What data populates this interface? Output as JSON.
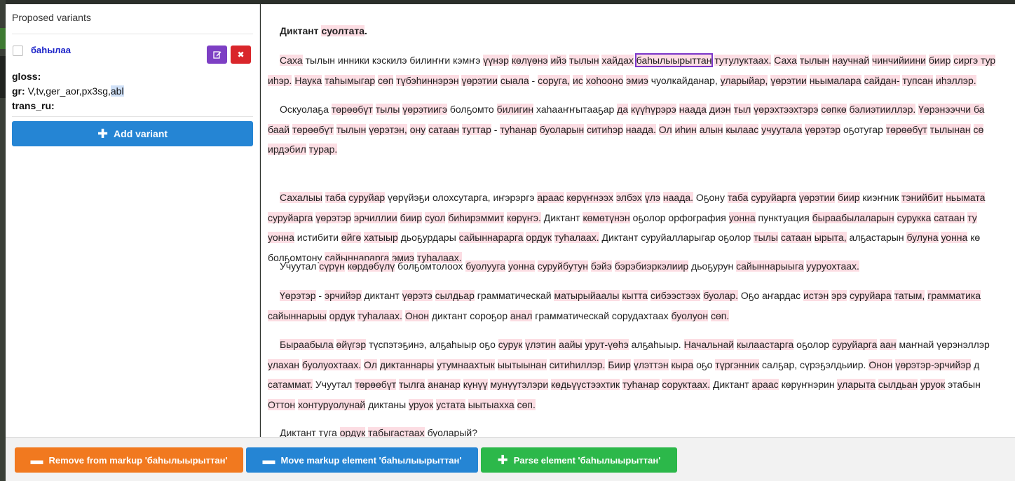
{
  "left_panel": {
    "title": "Proposed variants",
    "variant": {
      "word": "баһылаа",
      "edit_icon": "pencil-icon",
      "delete_icon": "close-icon",
      "gloss_label": "gloss:",
      "gloss_value": "",
      "gr_label": "gr:",
      "gr_value": "V,tv,ger_aor,px3sg,",
      "gr_selected": "abl",
      "trans_label": "trans_ru:",
      "trans_value": ""
    },
    "add_button": "Add variant"
  },
  "text": {
    "title_word1": "Диктант",
    "title_word2": "суолтата",
    "p1": {
      "a": "Саха",
      "b": " тылын",
      "c": " инники кэскилэ билиҥҥи кэмҥэ ",
      "d": "үүнэр",
      "e": " ",
      "f": "көлүөнэ",
      "g": " ",
      "h": "ийэ",
      "i": " ",
      "j": "тылын",
      "k": " ",
      "l": "хайдах",
      "m": " ",
      "boxed": "баһылыырыттан",
      "n": " ",
      "o": "тутулуктаах.",
      "p": " ",
      "q": "Саха",
      "r": " ",
      "s": "тылын",
      "t": " ",
      "u": "научнай",
      "v": " ",
      "w": "чинчийиини",
      "x": " ",
      "y": "биир",
      "z": " ",
      "aa": "сиргэ",
      "ab": " тур",
      "line2a": "иһэр.",
      "line2b": " ",
      "line2c": "Наука",
      "line2d": " ",
      "line2e": "таһымыгар",
      "line2f": " ",
      "line2g": "сөп",
      "line2h": " ",
      "line2i": "түбэһиннэрэн",
      "line2j": " ",
      "line2k": "үөрэтии",
      "line2l": " ",
      "line2m": "сыала",
      "line2n": " - ",
      "line2o": "соруга,",
      "line2p": " ",
      "line2q": "ис",
      "line2r": " ",
      "line2s": "хоһооно",
      "line2t": " ",
      "line2u": "эмиэ",
      "line2v": " чуолкайданар, ",
      "line2w": "уларыйар,",
      "line2x": " ",
      "line2y": "үөрэтии",
      "line2z": " ",
      "line2aa": "ньымалара",
      "line2ab": " ",
      "line2ac": "сайдан-",
      "line2ad": " ",
      "line2ae": "тупсан",
      "line2af": " ",
      "line2ag": "иһэллэр."
    },
    "p2_line1": [
      {
        "t": "Оскуолаҕа ",
        "h": false
      },
      {
        "t": "төрөөбүт",
        "h": true
      },
      {
        "t": " ",
        "h": false
      },
      {
        "t": "тылы",
        "h": true
      },
      {
        "t": " ",
        "h": false
      },
      {
        "t": "үөрэтиигэ",
        "h": true
      },
      {
        "t": " болҕомто ",
        "h": false
      },
      {
        "t": "билигин",
        "h": true
      },
      {
        "t": " хаһааҥҥытааҕар ",
        "h": false
      },
      {
        "t": "да",
        "h": true
      },
      {
        "t": " ",
        "h": false
      },
      {
        "t": "күүһүрэрэ",
        "h": true
      },
      {
        "t": " ",
        "h": false
      },
      {
        "t": "наада",
        "h": true
      },
      {
        "t": " ",
        "h": false
      },
      {
        "t": "диэн",
        "h": true
      },
      {
        "t": " ",
        "h": false
      },
      {
        "t": "тыл",
        "h": true
      },
      {
        "t": " ",
        "h": false
      },
      {
        "t": "үөрэхтээхтэрэ",
        "h": true
      },
      {
        "t": " ",
        "h": false
      },
      {
        "t": "сөпкө",
        "h": true
      },
      {
        "t": " ",
        "h": false
      },
      {
        "t": "бэлиэтииллэр.",
        "h": true
      },
      {
        "t": " ",
        "h": false
      },
      {
        "t": "Үөрэнээччи ба",
        "h": true
      }
    ],
    "p2_line2": [
      {
        "t": "баай",
        "h": true
      },
      {
        "t": " ",
        "h": false
      },
      {
        "t": "төрөөбүт",
        "h": true
      },
      {
        "t": " ",
        "h": false
      },
      {
        "t": "тылын",
        "h": true
      },
      {
        "t": " ",
        "h": false
      },
      {
        "t": "үөрэтэн,",
        "h": true
      },
      {
        "t": " ",
        "h": false
      },
      {
        "t": "ону",
        "h": true
      },
      {
        "t": " ",
        "h": false
      },
      {
        "t": "сатаан",
        "h": true
      },
      {
        "t": " ",
        "h": false
      },
      {
        "t": "туттар",
        "h": true
      },
      {
        "t": " - ",
        "h": false
      },
      {
        "t": "туһанар",
        "h": true
      },
      {
        "t": " ",
        "h": false
      },
      {
        "t": "буоларын",
        "h": true
      },
      {
        "t": " ",
        "h": false
      },
      {
        "t": "ситиһэр",
        "h": true
      },
      {
        "t": " ",
        "h": false
      },
      {
        "t": "наада.",
        "h": true
      },
      {
        "t": " ",
        "h": false
      },
      {
        "t": "Ол",
        "h": true
      },
      {
        "t": " ",
        "h": false
      },
      {
        "t": "иһин",
        "h": true
      },
      {
        "t": " ",
        "h": false
      },
      {
        "t": "алын",
        "h": true
      },
      {
        "t": " ",
        "h": false
      },
      {
        "t": "кылаас",
        "h": true
      },
      {
        "t": " ",
        "h": false
      },
      {
        "t": "учуутала",
        "h": true
      },
      {
        "t": " ",
        "h": false
      },
      {
        "t": "үөрэтэр",
        "h": true
      },
      {
        "t": " оҕотугар ",
        "h": false
      },
      {
        "t": "төрөөбүт",
        "h": true
      },
      {
        "t": " ",
        "h": false
      },
      {
        "t": "тылынан",
        "h": true
      },
      {
        "t": " ",
        "h": false
      },
      {
        "t": "сө",
        "h": true
      }
    ],
    "p2_line3": [
      {
        "t": "ирдэбил",
        "h": true
      },
      {
        "t": " ",
        "h": false
      },
      {
        "t": "турар.",
        "h": true
      }
    ],
    "p3_line1": [
      {
        "t": "Сахалыы",
        "h": true
      },
      {
        "t": " ",
        "h": false
      },
      {
        "t": "таба",
        "h": true
      },
      {
        "t": " ",
        "h": false
      },
      {
        "t": "суруйар",
        "h": true
      },
      {
        "t": " үөрүйэҕи олохсутарга, иҥэрэргэ ",
        "h": false
      },
      {
        "t": "араас",
        "h": true
      },
      {
        "t": " ",
        "h": false
      },
      {
        "t": "көрүҥнээх",
        "h": true
      },
      {
        "t": " ",
        "h": false
      },
      {
        "t": "элбэх",
        "h": true
      },
      {
        "t": " ",
        "h": false
      },
      {
        "t": "үлэ",
        "h": true
      },
      {
        "t": " ",
        "h": false
      },
      {
        "t": "наада.",
        "h": true
      },
      {
        "t": " Оҕону ",
        "h": false
      },
      {
        "t": "таба",
        "h": true
      },
      {
        "t": " ",
        "h": false
      },
      {
        "t": "суруйарга",
        "h": true
      },
      {
        "t": " ",
        "h": false
      },
      {
        "t": "үөрэтии",
        "h": true
      },
      {
        "t": " ",
        "h": false
      },
      {
        "t": "биир",
        "h": true
      },
      {
        "t": " киэҥник ",
        "h": false
      },
      {
        "t": "тэнийбит",
        "h": true
      },
      {
        "t": " ",
        "h": false
      },
      {
        "t": "ньымата",
        "h": true
      }
    ],
    "p3_line2": [
      {
        "t": "суруйарга",
        "h": true
      },
      {
        "t": " ",
        "h": false
      },
      {
        "t": "үөрэтэр",
        "h": true
      },
      {
        "t": " ",
        "h": false
      },
      {
        "t": "эрчиллии",
        "h": true
      },
      {
        "t": " ",
        "h": false
      },
      {
        "t": "биир",
        "h": true
      },
      {
        "t": " ",
        "h": false
      },
      {
        "t": "суол",
        "h": true
      },
      {
        "t": " ",
        "h": false
      },
      {
        "t": "биһирэммит",
        "h": true
      },
      {
        "t": " ",
        "h": false
      },
      {
        "t": "көрүҥэ.",
        "h": true
      },
      {
        "t": " Диктант ",
        "h": false
      },
      {
        "t": "көмөтүнэн",
        "h": true
      },
      {
        "t": " оҕолор орфография ",
        "h": false
      },
      {
        "t": "уонна",
        "h": true
      },
      {
        "t": " пунктуация ",
        "h": false
      },
      {
        "t": "быраабылаларын",
        "h": true
      },
      {
        "t": " ",
        "h": false
      },
      {
        "t": "сурукка",
        "h": true
      },
      {
        "t": " ",
        "h": false
      },
      {
        "t": "сатаан",
        "h": true
      },
      {
        "t": " ",
        "h": false
      },
      {
        "t": "ту",
        "h": true
      }
    ],
    "p3_line3": [
      {
        "t": "уонна",
        "h": true
      },
      {
        "t": " истибити ",
        "h": false
      },
      {
        "t": "өйгө",
        "h": true
      },
      {
        "t": " ",
        "h": false
      },
      {
        "t": "хатыыр",
        "h": true
      },
      {
        "t": " дьоҕурдары ",
        "h": false
      },
      {
        "t": "сайыннарарга",
        "h": true
      },
      {
        "t": " ",
        "h": false
      },
      {
        "t": "ордук",
        "h": true
      },
      {
        "t": " ",
        "h": false
      },
      {
        "t": "туһалаах.",
        "h": true
      },
      {
        "t": " Диктант суруйалларыгар оҕолор ",
        "h": false
      },
      {
        "t": "тылы",
        "h": true
      },
      {
        "t": " ",
        "h": false
      },
      {
        "t": "сатаан",
        "h": true
      },
      {
        "t": " ",
        "h": false
      },
      {
        "t": "ырыта,",
        "h": true
      },
      {
        "t": " алҕастарын ",
        "h": false
      },
      {
        "t": "булуна",
        "h": true
      },
      {
        "t": " ",
        "h": false
      },
      {
        "t": "уонна",
        "h": true
      },
      {
        "t": "  кө",
        "h": false
      }
    ],
    "p3_line4": [
      {
        "t": "болҕомтону ",
        "h": false
      },
      {
        "t": "сайыннарарга",
        "h": true
      },
      {
        "t": " ",
        "h": false
      },
      {
        "t": "эмиэ",
        "h": true
      },
      {
        "t": " ",
        "h": false
      },
      {
        "t": "туһалаах.",
        "h": true
      }
    ],
    "p4_line1": [
      {
        "t": "Учуутал ",
        "h": false
      },
      {
        "t": "сүрүн",
        "h": true
      },
      {
        "t": " ",
        "h": false
      },
      {
        "t": "көрдөбүлү",
        "h": true
      },
      {
        "t": " болҕомтолоох ",
        "h": false
      },
      {
        "t": "буолууга",
        "h": true
      },
      {
        "t": " ",
        "h": false
      },
      {
        "t": "уонна",
        "h": true
      },
      {
        "t": " ",
        "h": false
      },
      {
        "t": "суруйбутун",
        "h": true
      },
      {
        "t": " ",
        "h": false
      },
      {
        "t": "бэйэ",
        "h": true
      },
      {
        "t": " ",
        "h": false
      },
      {
        "t": "бэрэбиэркэлиир",
        "h": true
      },
      {
        "t": " дьоҕурун ",
        "h": false
      },
      {
        "t": "сайыннарыыга",
        "h": true
      },
      {
        "t": " ",
        "h": false
      },
      {
        "t": "ууруохтаах.",
        "h": true
      }
    ],
    "p5_line1": [
      {
        "t": "Үөрэтэр",
        "h": true
      },
      {
        "t": " - ",
        "h": false
      },
      {
        "t": "эрчийэр",
        "h": true
      },
      {
        "t": " диктант ",
        "h": false
      },
      {
        "t": "үөрэтэ",
        "h": true
      },
      {
        "t": " ",
        "h": false
      },
      {
        "t": "сылдьар",
        "h": true
      },
      {
        "t": " грамматическай ",
        "h": false
      },
      {
        "t": "матырыйаалы",
        "h": true
      },
      {
        "t": " ",
        "h": false
      },
      {
        "t": "кытта",
        "h": true
      },
      {
        "t": " ",
        "h": false
      },
      {
        "t": "сибээстээх",
        "h": true
      },
      {
        "t": " ",
        "h": false
      },
      {
        "t": "буолар.",
        "h": true
      },
      {
        "t": " Оҕо аҥардас ",
        "h": false
      },
      {
        "t": "истэн",
        "h": true
      },
      {
        "t": " ",
        "h": false
      },
      {
        "t": "эрэ",
        "h": true
      },
      {
        "t": " ",
        "h": false
      },
      {
        "t": "суруйара",
        "h": true
      },
      {
        "t": " ",
        "h": false
      },
      {
        "t": "татым,",
        "h": true
      },
      {
        "t": " ",
        "h": false
      },
      {
        "t": "грамматика",
        "h": true
      }
    ],
    "p5_line2": [
      {
        "t": "сайыннарыы",
        "h": true
      },
      {
        "t": " ",
        "h": false
      },
      {
        "t": "ордук",
        "h": true
      },
      {
        "t": " ",
        "h": false
      },
      {
        "t": "туһалаах.",
        "h": true
      },
      {
        "t": " ",
        "h": false
      },
      {
        "t": "Онон",
        "h": true
      },
      {
        "t": " диктант сороҕор ",
        "h": false
      },
      {
        "t": "анал",
        "h": true
      },
      {
        "t": " грамматическай сорудахтаах ",
        "h": false
      },
      {
        "t": "буолуон",
        "h": true
      },
      {
        "t": " ",
        "h": false
      },
      {
        "t": "сөп.",
        "h": true
      }
    ],
    "p6_line1": [
      {
        "t": "Быраабыла",
        "h": true
      },
      {
        "t": " ",
        "h": false
      },
      {
        "t": "өйүгэр",
        "h": true
      },
      {
        "t": " түспэтэҕинэ, алҕаһыыр оҕо ",
        "h": false
      },
      {
        "t": "сурук",
        "h": true
      },
      {
        "t": " ",
        "h": false
      },
      {
        "t": "үлэтин",
        "h": true
      },
      {
        "t": " ",
        "h": false
      },
      {
        "t": "аайы",
        "h": true
      },
      {
        "t": " ",
        "h": false
      },
      {
        "t": "урут-үөһэ",
        "h": true
      },
      {
        "t": " алҕаһыыр. ",
        "h": false
      },
      {
        "t": "Начальнай",
        "h": true
      },
      {
        "t": " ",
        "h": false
      },
      {
        "t": "кылаастарга",
        "h": true
      },
      {
        "t": " оҕолор ",
        "h": false
      },
      {
        "t": "суруйарга",
        "h": true
      },
      {
        "t": " ",
        "h": false
      },
      {
        "t": "аан",
        "h": true
      },
      {
        "t": " маҥнай үөрэнэллэр",
        "h": false
      }
    ],
    "p6_line2": [
      {
        "t": "улахан",
        "h": true
      },
      {
        "t": " ",
        "h": false
      },
      {
        "t": "буолуохтаах.",
        "h": true
      },
      {
        "t": " ",
        "h": false
      },
      {
        "t": "Ол",
        "h": true
      },
      {
        "t": " ",
        "h": false
      },
      {
        "t": "диктаннары",
        "h": true
      },
      {
        "t": " ",
        "h": false
      },
      {
        "t": "утумнаахтык",
        "h": true
      },
      {
        "t": " ",
        "h": false
      },
      {
        "t": "ыытыынан",
        "h": true
      },
      {
        "t": " ",
        "h": false
      },
      {
        "t": "ситиһиллэр.",
        "h": true
      },
      {
        "t": " ",
        "h": false
      },
      {
        "t": "Биир",
        "h": true
      },
      {
        "t": " ",
        "h": false
      },
      {
        "t": "үлэттэн",
        "h": true
      },
      {
        "t": " ",
        "h": false
      },
      {
        "t": "кыра",
        "h": true
      },
      {
        "t": " оҕо ",
        "h": false
      },
      {
        "t": "түргэнник",
        "h": true
      },
      {
        "t": " салҕар, сүрэҕэлдьиир. ",
        "h": false
      },
      {
        "t": "Онон",
        "h": true
      },
      {
        "t": " ",
        "h": false
      },
      {
        "t": "үөрэтэр-эрчийэр",
        "h": true
      },
      {
        "t": " д",
        "h": false
      }
    ],
    "p6_line3": [
      {
        "t": "сатаммат.",
        "h": true
      },
      {
        "t": " Учуутал ",
        "h": false
      },
      {
        "t": "төрөөбүт",
        "h": true
      },
      {
        "t": " ",
        "h": false
      },
      {
        "t": "тылга",
        "h": true
      },
      {
        "t": " ",
        "h": false
      },
      {
        "t": "ананар",
        "h": true
      },
      {
        "t": " ",
        "h": false
      },
      {
        "t": "күнүү",
        "h": true
      },
      {
        "t": " ",
        "h": false
      },
      {
        "t": "мунүүтэлэри",
        "h": true
      },
      {
        "t": " ",
        "h": false
      },
      {
        "t": "көдьүүстээхтик",
        "h": true
      },
      {
        "t": " ",
        "h": false
      },
      {
        "t": "туһанар",
        "h": true
      },
      {
        "t": " ",
        "h": false
      },
      {
        "t": "соруктаах.",
        "h": true
      },
      {
        "t": " Диктант ",
        "h": false
      },
      {
        "t": "араас",
        "h": true
      },
      {
        "t": " көрүҥнэрин ",
        "h": false
      },
      {
        "t": "уларыта",
        "h": true
      },
      {
        "t": " ",
        "h": false
      },
      {
        "t": "сылдьан",
        "h": true
      },
      {
        "t": " ",
        "h": false
      },
      {
        "t": "уруок",
        "h": true
      },
      {
        "t": " этабын",
        "h": false
      }
    ],
    "p6_line4": [
      {
        "t": "Оттон",
        "h": true
      },
      {
        "t": " ",
        "h": false
      },
      {
        "t": "хонтуруолунай",
        "h": true
      },
      {
        "t": " диктаны ",
        "h": false
      },
      {
        "t": "уруок",
        "h": true
      },
      {
        "t": " ",
        "h": false
      },
      {
        "t": "устата",
        "h": true
      },
      {
        "t": " ",
        "h": false
      },
      {
        "t": "ыытыахха",
        "h": true
      },
      {
        "t": " ",
        "h": false
      },
      {
        "t": "сөп.",
        "h": true
      }
    ],
    "p7_line1": [
      {
        "t": "Диктант туга ",
        "h": false
      },
      {
        "t": "ордук",
        "h": true
      },
      {
        "t": " ",
        "h": false
      },
      {
        "t": "табыгастаах",
        "h": true
      },
      {
        "t": " буоларый?",
        "h": false
      }
    ]
  },
  "bottom_bar": {
    "remove_label": "Remove from markup 'баһылыырыттан'",
    "move_label": "Move markup element 'баһылыырыттан'",
    "parse_label": "Parse element 'баһылыырыттан'",
    "remove_icon": "minus-icon",
    "move_icon": "minus-icon",
    "parse_icon": "plus-icon"
  },
  "colors": {
    "highlight": "#fcdde3",
    "selected_box": "#7b36c9",
    "remove_button": "#f1791f",
    "move_button": "#2585d4",
    "parse_button": "#2cb84a",
    "add_button": "#2585d4",
    "edit_button": "#7d3fc4",
    "delete_button": "#d9262b"
  }
}
